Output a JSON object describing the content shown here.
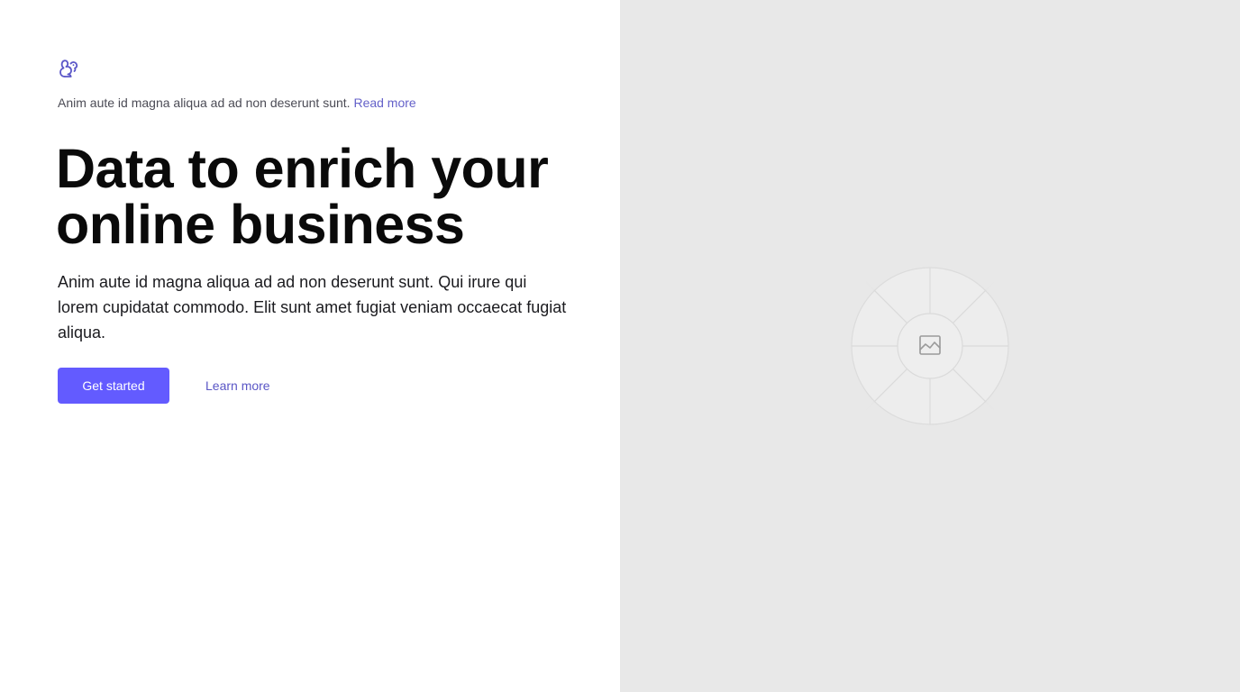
{
  "colors": {
    "accent": "#635bff",
    "link": "#6461c9",
    "placeholder_bg": "#e8e8e8"
  },
  "brand": {
    "logo_icon": "squirrel-logo-icon"
  },
  "announcement": {
    "text": "Anim aute id magna aliqua ad ad non deserunt sunt.",
    "link_label": "Read more"
  },
  "hero": {
    "headline": "Data to enrich your online business",
    "description": "Anim aute id magna aliqua ad ad non deserunt sunt. Qui irure qui lorem cupidatat commodo. Elit sunt amet fugiat veniam occaecat fugiat aliqua.",
    "primary_cta": "Get started",
    "secondary_cta": "Learn more"
  },
  "media": {
    "placeholder_icon": "image-icon"
  }
}
